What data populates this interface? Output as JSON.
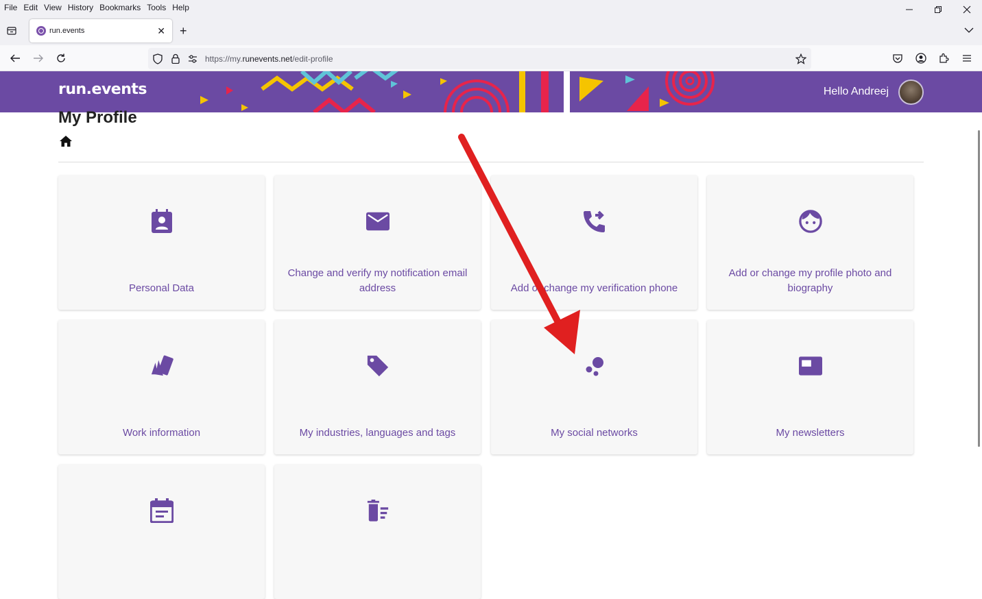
{
  "browser": {
    "menu": [
      "File",
      "Edit",
      "View",
      "History",
      "Bookmarks",
      "Tools",
      "Help"
    ],
    "tab_title": "run.events",
    "url_prefix": "https://my.",
    "url_domain": "runevents.net",
    "url_path": "/edit-profile"
  },
  "header": {
    "logo_text": "run.events",
    "greeting": "Hello Andreej",
    "brand_color": "#6b4aa3"
  },
  "page": {
    "title": "My Profile",
    "cards": [
      {
        "label": "Personal Data",
        "icon": "contact-card-icon"
      },
      {
        "label": "Change and verify my notification email address",
        "icon": "email-icon"
      },
      {
        "label": "Add or change my verification phone",
        "icon": "phone-forward-icon"
      },
      {
        "label": "Add or change my profile photo and biography",
        "icon": "face-icon"
      },
      {
        "label": "Work information",
        "icon": "swatches-icon"
      },
      {
        "label": "My industries, languages and tags",
        "icon": "tag-icon"
      },
      {
        "label": "My social networks",
        "icon": "bubbles-icon"
      },
      {
        "label": "My newsletters",
        "icon": "newsletter-icon"
      },
      {
        "label": "",
        "icon": "calendar-icon"
      },
      {
        "label": "",
        "icon": "delete-list-icon"
      }
    ]
  },
  "annotation": {
    "arrow_color": "#e02020"
  }
}
